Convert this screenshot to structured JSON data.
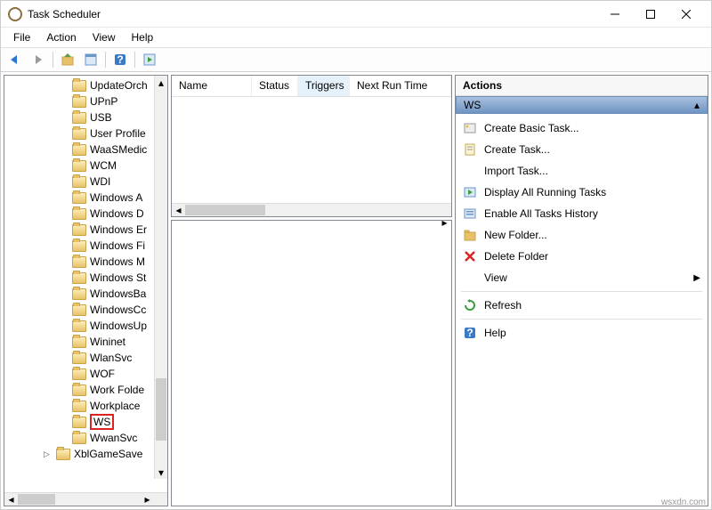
{
  "title": "Task Scheduler",
  "menu": [
    "File",
    "Action",
    "View",
    "Help"
  ],
  "tree": {
    "items": [
      {
        "label": "UpdateOrch"
      },
      {
        "label": "UPnP"
      },
      {
        "label": "USB"
      },
      {
        "label": "User Profile"
      },
      {
        "label": "WaaSMedic"
      },
      {
        "label": "WCM"
      },
      {
        "label": "WDI"
      },
      {
        "label": "Windows A"
      },
      {
        "label": "Windows D"
      },
      {
        "label": "Windows Er"
      },
      {
        "label": "Windows Fi"
      },
      {
        "label": "Windows M"
      },
      {
        "label": "Windows St"
      },
      {
        "label": "WindowsBa"
      },
      {
        "label": "WindowsCc"
      },
      {
        "label": "WindowsUp"
      },
      {
        "label": "Wininet"
      },
      {
        "label": "WlanSvc"
      },
      {
        "label": "WOF"
      },
      {
        "label": "Work Folde"
      },
      {
        "label": "Workplace"
      },
      {
        "label": "WS",
        "selected": true
      },
      {
        "label": "WwanSvc"
      },
      {
        "label": "XblGameSave",
        "level": "xbl",
        "expander": true
      }
    ]
  },
  "task_columns": [
    {
      "label": "Name"
    },
    {
      "label": "Status"
    },
    {
      "label": "Triggers",
      "sorted": true
    },
    {
      "label": "Next Run Time"
    }
  ],
  "actions": {
    "header": "Actions",
    "context": "WS",
    "items": [
      {
        "icon": "wizard",
        "label": "Create Basic Task..."
      },
      {
        "icon": "task",
        "label": "Create Task..."
      },
      {
        "icon": "blank",
        "label": "Import Task..."
      },
      {
        "icon": "running",
        "label": "Display All Running Tasks"
      },
      {
        "icon": "history",
        "label": "Enable All Tasks History"
      },
      {
        "icon": "newfolder",
        "label": "New Folder..."
      },
      {
        "icon": "delete",
        "label": "Delete Folder"
      },
      {
        "icon": "blank",
        "label": "View",
        "arrow": true
      },
      {
        "sep": true
      },
      {
        "icon": "refresh",
        "label": "Refresh"
      },
      {
        "sep": true
      },
      {
        "icon": "help",
        "label": "Help"
      }
    ]
  },
  "watermark": "wsxdn.com"
}
